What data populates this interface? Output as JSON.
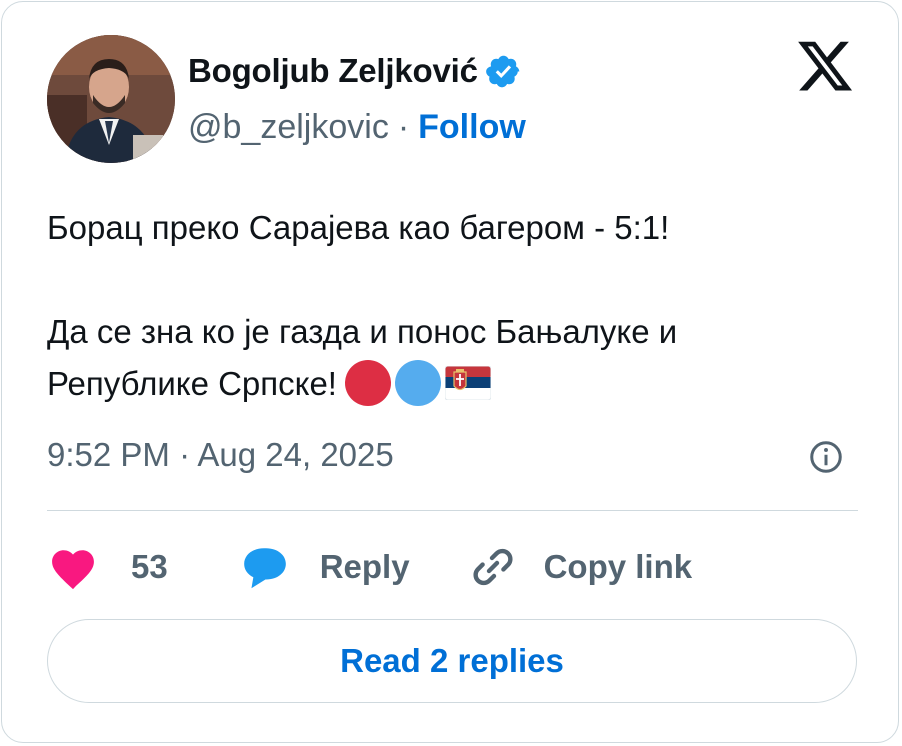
{
  "author": {
    "name": "Bogoljub Zeljković",
    "handle": "@b_zeljkovic",
    "separator": "·",
    "follow_label": "Follow",
    "verified_icon": "verified-badge-icon",
    "verified_color": "#1d9bf0"
  },
  "brand": {
    "logo_icon": "x-logo-icon"
  },
  "tweet": {
    "line1": "Борац преко Сарајева као багером - 5:1!",
    "line2": "Да се зна ко је газда и понос Бањалуке и",
    "line3": "Републике Српске!",
    "emojis": [
      {
        "icon": "red-circle-emoji",
        "color": "#dd2e44"
      },
      {
        "icon": "blue-circle-emoji",
        "color": "#55acee"
      },
      {
        "icon": "serbia-flag-emoji"
      }
    ],
    "timestamp": "9:52 PM · Aug 24, 2025"
  },
  "actions": {
    "like_count": "53",
    "like_color": "#f91880",
    "reply_label": "Reply",
    "reply_color": "#1d9bf0",
    "copy_label": "Copy link"
  },
  "footer": {
    "read_replies_label": "Read 2 replies"
  },
  "colors": {
    "link": "#006fd6",
    "muted": "#536471",
    "text": "#0f1419",
    "border": "#cfd9de"
  }
}
